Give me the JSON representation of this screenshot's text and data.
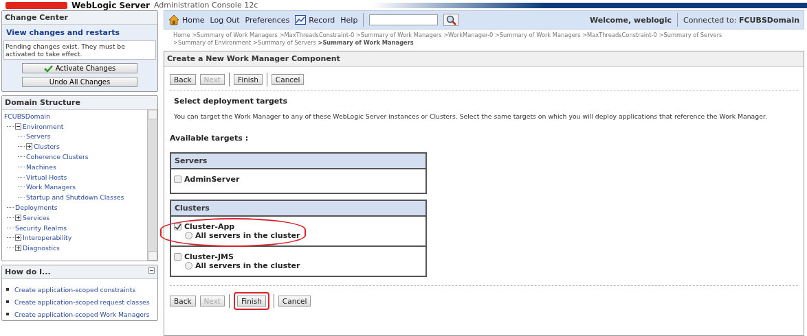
{
  "header": {
    "product": "WebLogic Server",
    "subtitle": "Administration Console 12c"
  },
  "change_center": {
    "title": "Change Center",
    "link": "View changes and restarts",
    "message": "Pending changes exist. They must be activated to take effect.",
    "buttons": [
      {
        "label": "Activate Changes",
        "kind": "check"
      },
      {
        "label": "Undo All Changes",
        "kind": "plain"
      }
    ]
  },
  "domain_structure": {
    "title": "Domain Structure",
    "tree": [
      {
        "label": "FCUBSDomain",
        "children": [
          {
            "label": "Environment",
            "expanded": true,
            "children": [
              {
                "label": "Servers"
              },
              {
                "label": "Clusters",
                "expanded": false
              },
              {
                "label": "Coherence Clusters"
              },
              {
                "label": "Machines"
              },
              {
                "label": "Virtual Hosts"
              },
              {
                "label": "Work Managers"
              },
              {
                "label": "Startup and Shutdown Classes"
              }
            ]
          },
          {
            "label": "Deployments"
          },
          {
            "label": "Services",
            "expanded": false
          },
          {
            "label": "Security Realms"
          },
          {
            "label": "Interoperability",
            "expanded": false
          },
          {
            "label": "Diagnostics",
            "expanded": false
          }
        ]
      }
    ]
  },
  "how_do_i": {
    "title": "How do I...",
    "links": [
      "Create application-scoped constraints",
      "Create application-scoped request classes",
      "Create application-scoped Work Managers"
    ]
  },
  "toolbar": {
    "links": [
      {
        "label": "Home",
        "kind": "home"
      },
      {
        "label": "Log Out",
        "kind": "plain"
      },
      {
        "label": "Preferences",
        "kind": "plain"
      },
      {
        "label": "Record",
        "kind": "record"
      },
      {
        "label": "Help",
        "kind": "plain"
      }
    ],
    "welcome": "Welcome, weblogic",
    "connected_label": "Connected to:",
    "connected_domain": "FCUBSDomain"
  },
  "breadcrumb": [
    "Home",
    ">Summary of Work Managers",
    ">MaxThreadsConstraint-0",
    ">Summary of Work Managers",
    ">WorkManager-0",
    ">Summary of Work Managers",
    ">MaxThreadsConstraint-0",
    ">Summary of Servers",
    ">Summary of Environment",
    ">Summary of Servers",
    ">Summary of Work Managers"
  ],
  "wizard": {
    "title": "Create a New Work Manager Component",
    "buttons": [
      {
        "label": "Back",
        "disabled": false
      },
      {
        "label": "Next",
        "disabled": true
      },
      {
        "label": "Finish",
        "disabled": false
      },
      {
        "label": "Cancel",
        "disabled": false
      }
    ],
    "heading": "Select deployment targets",
    "description": "You can target the Work Manager to any of these WebLogic Server instances or Clusters. Select the same targets on which you will deploy applications that reference the Work Manager.",
    "targets_label": "Available targets :",
    "servers": {
      "title": "Servers",
      "rows": [
        {
          "name": "AdminServer",
          "checked": false
        }
      ]
    },
    "clusters": {
      "title": "Clusters",
      "rows": [
        {
          "name": "Cluster-App",
          "checked": true,
          "highlighted": true,
          "option": {
            "label": "All servers in the cluster",
            "selected": false
          }
        },
        {
          "name": "Cluster-JMS",
          "checked": false,
          "highlighted": false,
          "option": {
            "label": "All servers in the cluster",
            "selected": false
          }
        }
      ]
    },
    "bottom_buttons": [
      {
        "label": "Back",
        "disabled": false,
        "highlighted": false
      },
      {
        "label": "Next",
        "disabled": true,
        "highlighted": false
      },
      {
        "label": "Finish",
        "disabled": false,
        "highlighted": true
      },
      {
        "label": "Cancel",
        "disabled": false,
        "highlighted": false
      }
    ]
  }
}
